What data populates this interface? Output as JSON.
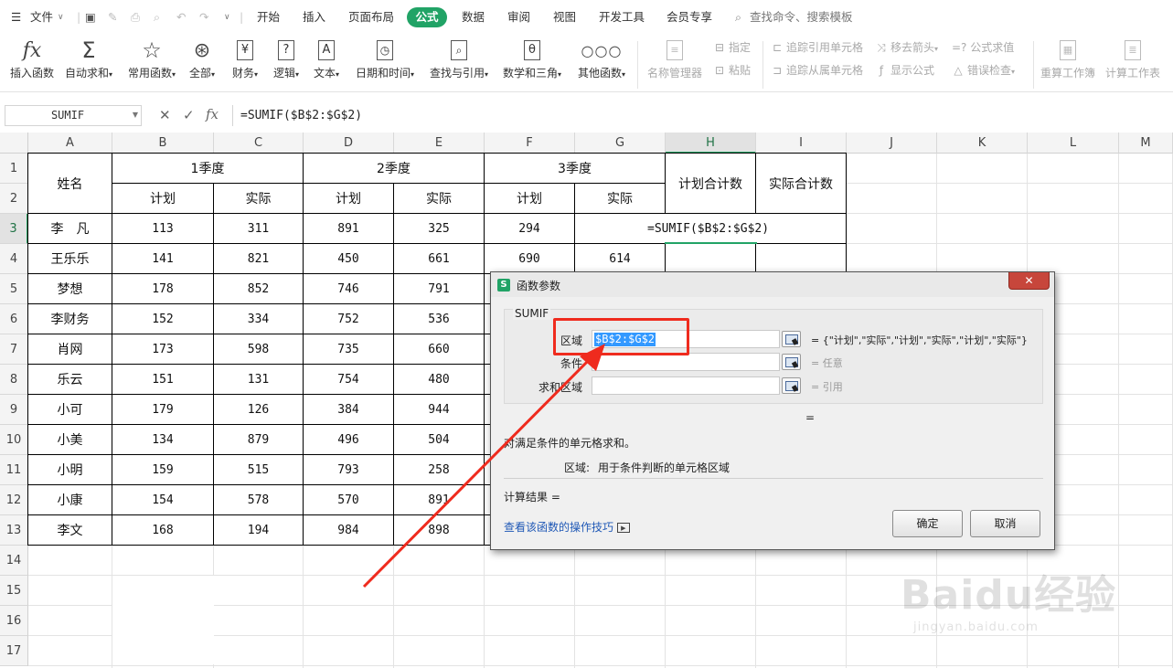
{
  "menubar": {
    "file": "文件",
    "tabs": [
      "开始",
      "插入",
      "页面布局",
      "公式",
      "数据",
      "审阅",
      "视图",
      "开发工具",
      "会员专享"
    ],
    "active_tab": "公式",
    "search_placeholder": "查找命令、搜索模板"
  },
  "ribbon": {
    "large_buttons": [
      {
        "label": "插入函数",
        "icon": "fx-icon"
      },
      {
        "label": "自动求和",
        "icon": "sigma-icon"
      },
      {
        "label": "常用函数",
        "icon": "star-icon"
      },
      {
        "label": "全部",
        "icon": "asterisk-circle-icon"
      },
      {
        "label": "财务",
        "icon": "yen-icon"
      },
      {
        "label": "逻辑",
        "icon": "question-icon"
      },
      {
        "label": "文本",
        "icon": "text-A-icon"
      },
      {
        "label": "日期和时间",
        "icon": "clock-icon"
      },
      {
        "label": "查找与引用",
        "icon": "lookup-icon"
      },
      {
        "label": "数学和三角",
        "icon": "theta-icon"
      },
      {
        "label": "其他函数",
        "icon": "more-icon"
      },
      {
        "label": "名称管理器",
        "icon": "name-manager-icon"
      }
    ],
    "small_buttons": {
      "assign": "指定",
      "paste": "粘贴",
      "trace_precedents": "追踪引用单元格",
      "trace_dependents": "追踪从属单元格",
      "remove_arrows": "移去箭头",
      "show_formulas": "显示公式",
      "evaluate": "=? 公式求值",
      "error_check": "错误检查"
    },
    "right_buttons": [
      "重算工作簿",
      "计算工作表"
    ]
  },
  "formula_bar": {
    "name_box": "SUMIF",
    "cancel": "✕",
    "confirm": "✓",
    "fx": "fx",
    "formula": "=SUMIF($B$2:$G$2)"
  },
  "columns": [
    "A",
    "B",
    "C",
    "D",
    "E",
    "F",
    "G",
    "H",
    "I",
    "J",
    "K",
    "L",
    "M"
  ],
  "rows": [
    "1",
    "2",
    "3",
    "4",
    "5",
    "6",
    "7",
    "8",
    "9",
    "10",
    "11",
    "12",
    "13",
    "14",
    "15",
    "16",
    "17"
  ],
  "sheet": {
    "name_header": "姓名",
    "quarters": [
      "1季度",
      "2季度",
      "3季度"
    ],
    "plan": "计划",
    "actual": "实际",
    "plan_total": "计划合计数",
    "actual_total": "实际合计数",
    "formula_cell": "=SUMIF($B$2:$G$2)",
    "data": [
      {
        "name": "李　凡",
        "values": [
          "113",
          "311",
          "891",
          "325",
          "294",
          ""
        ]
      },
      {
        "name": "王乐乐",
        "values": [
          "141",
          "821",
          "450",
          "661",
          "690",
          "614"
        ]
      },
      {
        "name": "梦想",
        "values": [
          "178",
          "852",
          "746",
          "791",
          "",
          ""
        ]
      },
      {
        "name": "李财务",
        "values": [
          "152",
          "334",
          "752",
          "536",
          "",
          ""
        ]
      },
      {
        "name": "肖网",
        "values": [
          "173",
          "598",
          "735",
          "660",
          "",
          ""
        ]
      },
      {
        "name": "乐云",
        "values": [
          "151",
          "131",
          "754",
          "480",
          "",
          ""
        ]
      },
      {
        "name": "小可",
        "values": [
          "179",
          "126",
          "384",
          "944",
          "",
          ""
        ]
      },
      {
        "name": "小美",
        "values": [
          "134",
          "879",
          "496",
          "504",
          "",
          ""
        ]
      },
      {
        "name": "小明",
        "values": [
          "159",
          "515",
          "793",
          "258",
          "",
          ""
        ]
      },
      {
        "name": "小康",
        "values": [
          "154",
          "578",
          "570",
          "891",
          "",
          ""
        ]
      },
      {
        "name": "李文",
        "values": [
          "168",
          "194",
          "984",
          "898",
          "",
          ""
        ]
      }
    ]
  },
  "dialog": {
    "title": "函数参数",
    "close": "✕",
    "group_label": "SUMIF",
    "args": [
      {
        "label": "区域",
        "value": "$B$2:$G$2",
        "result": "= {\"计划\",\"实际\",\"计划\",\"实际\",\"计划\",\"实际\"}"
      },
      {
        "label": "条件",
        "value": "",
        "result": "= 任意"
      },
      {
        "label": "求和区域",
        "value": "",
        "result": "= 引用"
      }
    ],
    "equals": "=",
    "description": "对满足条件的单元格求和。",
    "arg_help_label": "区域:",
    "arg_help": "用于条件判断的单元格区域",
    "calc_result": "计算结果 =",
    "help_link": "查看该函数的操作技巧",
    "ok": "确定",
    "cancel": "取消"
  },
  "watermark": {
    "brand": "Baidu经验",
    "url": "jingyan.baidu.com"
  },
  "colors": {
    "accent": "#21a366",
    "highlight": "#ef2b1e",
    "selection": "#3399ff"
  }
}
